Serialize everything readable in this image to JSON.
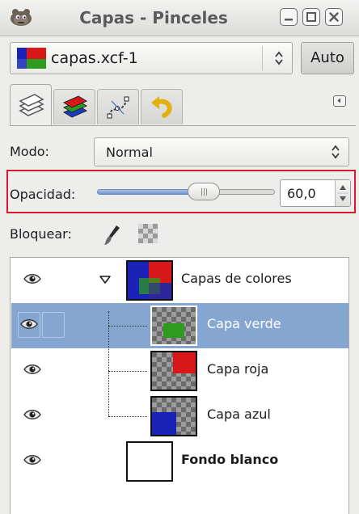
{
  "window": {
    "title": "Capas - Pinceles",
    "controls": [
      "minimize-icon",
      "maximize-icon",
      "close-icon"
    ]
  },
  "image_selector": {
    "value": "capas.xcf-1",
    "auto_label": "Auto"
  },
  "tabs": [
    {
      "icon": "layers-icon",
      "active": true
    },
    {
      "icon": "channels-icon",
      "active": false
    },
    {
      "icon": "paths-icon",
      "active": false
    },
    {
      "icon": "undo-history-icon",
      "active": false
    }
  ],
  "mode": {
    "label": "Modo:",
    "value": "Normal"
  },
  "opacity": {
    "label": "Opacidad:",
    "value": "60,0",
    "percent": 60
  },
  "lock": {
    "label": "Bloquear:",
    "icons": [
      "brush-lock-icon",
      "alpha-lock-icon"
    ]
  },
  "layers": [
    {
      "name": "Capas de colores",
      "group": true,
      "selected": false,
      "bold": false,
      "depth": 0
    },
    {
      "name": "Capa verde",
      "group": false,
      "selected": true,
      "bold": false,
      "depth": 1
    },
    {
      "name": "Capa roja",
      "group": false,
      "selected": false,
      "bold": false,
      "depth": 1
    },
    {
      "name": "Capa azul",
      "group": false,
      "selected": false,
      "bold": false,
      "depth": 1
    },
    {
      "name": "Fondo blanco",
      "group": false,
      "selected": false,
      "bold": true,
      "depth": 0
    }
  ],
  "colors": {
    "selection": "#86a6d2",
    "highlight_outline": "#d41a2b",
    "red": "#d81818",
    "green": "#2e9a1f",
    "blue": "#1a22b8"
  }
}
